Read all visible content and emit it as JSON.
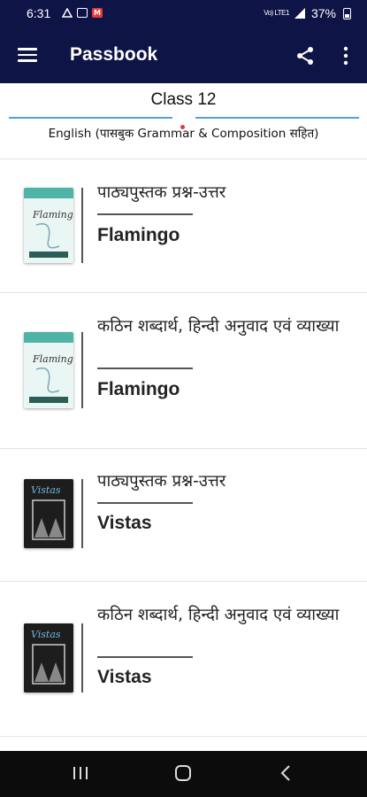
{
  "status_bar": {
    "time": "6:31",
    "battery_percent": "37%",
    "network_text": "Vo) LTE1"
  },
  "app_bar": {
    "title": "Passbook",
    "menu_icon": "hamburger-menu-icon",
    "share_icon": "share-icon",
    "more_icon": "more-vertical-icon"
  },
  "header": {
    "class_title": "Class 12",
    "subject": "English (पासबुक Grammar & Composition सहित)"
  },
  "cards": [
    {
      "heading": "पाठ्यपुस्तक प्रश्न-उत्तर",
      "book": "Flamingo",
      "cover": "flamingo"
    },
    {
      "heading": "कठिन शब्दार्थ, हिन्दी अनुवाद एवं व्याख्या",
      "book": "Flamingo",
      "cover": "flamingo"
    },
    {
      "heading": "पाठ्यपुस्तक प्रश्न-उत्तर",
      "book": "Vistas",
      "cover": "vistas"
    },
    {
      "heading": "कठिन शब्दार्थ, हिन्दी अनुवाद एवं व्याख्या",
      "book": "Vistas",
      "cover": "vistas"
    }
  ],
  "nav_bar": {
    "recent_icon": "recent-apps-icon",
    "home_icon": "home-icon",
    "back_icon": "back-icon"
  },
  "colors": {
    "app_bar": "#0e1445",
    "accent_line": "#5a9fd4",
    "nav_bar": "#0c0c0c"
  }
}
